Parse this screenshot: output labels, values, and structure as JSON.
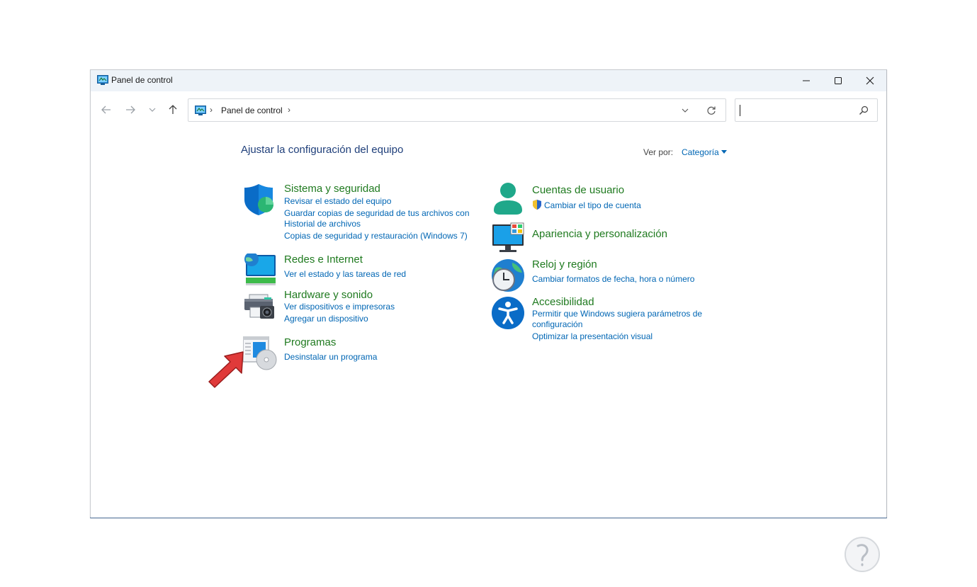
{
  "window": {
    "title": "Panel de control",
    "minimize_icon": "minimize-icon",
    "maximize_icon": "maximize-icon",
    "close_icon": "close-icon"
  },
  "navigation": {
    "breadcrumb": [
      "Panel de control"
    ],
    "search_placeholder": ""
  },
  "content": {
    "heading": "Ajustar la configuración del equipo",
    "view_by_label": "Ver por:",
    "view_by_value": "Categoría",
    "left_categories": [
      {
        "title": "Sistema y seguridad",
        "icon": "shield-icon",
        "links": [
          "Revisar el estado del equipo",
          "Guardar copias de seguridad de tus archivos con",
          "Historial de archivos",
          "Copias de seguridad y restauración (Windows 7)"
        ]
      },
      {
        "title": "Redes e Internet",
        "icon": "network-icon",
        "links": [
          "Ver el estado y las tareas de red"
        ]
      },
      {
        "title": "Hardware y sonido",
        "icon": "printer-icon",
        "links": [
          "Ver dispositivos e impresoras",
          "Agregar un dispositivo"
        ]
      },
      {
        "title": "Programas",
        "icon": "programs-icon",
        "links": [
          "Desinstalar un programa"
        ]
      }
    ],
    "right_categories": [
      {
        "title": "Cuentas de usuario",
        "icon": "user-icon",
        "links": [
          "Cambiar el tipo de cuenta"
        ]
      },
      {
        "title": "Apariencia y personalización",
        "icon": "monitor-icon",
        "links": []
      },
      {
        "title": "Reloj y región",
        "icon": "clock-globe-icon",
        "links": [
          "Cambiar formatos de fecha, hora o número"
        ]
      },
      {
        "title": "Accesibilidad",
        "icon": "accessibility-icon",
        "links": [
          "Permitir que Windows sugiera parámetros de",
          "configuración",
          "Optimizar la presentación visual"
        ]
      }
    ]
  },
  "colors": {
    "category_title": "#1f7a1f",
    "link": "#0066b4",
    "heading": "#1f3f7a",
    "annotation_arrow": "#e03a3a"
  }
}
